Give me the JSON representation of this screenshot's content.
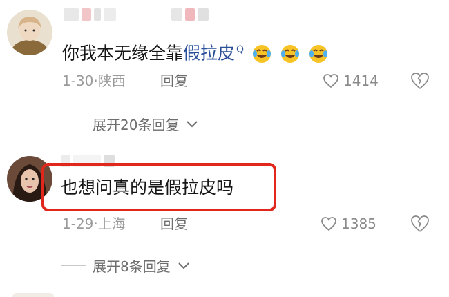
{
  "comments": [
    {
      "text_plain": "你我本无缘全靠",
      "text_link": "假拉皮",
      "search_glyph": "Q",
      "emoji_count": 3,
      "date": "1-30",
      "separator": "·",
      "location": "陕西",
      "reply_label": "回复",
      "likes": "1414",
      "expand_label": "展开20条回复"
    },
    {
      "text": "也想问真的是假拉皮吗",
      "date": "1-29",
      "separator": "·",
      "location": "上海",
      "reply_label": "回复",
      "likes": "1385",
      "expand_label": "展开8条回复"
    }
  ],
  "colors": {
    "highlight": "#e1261c",
    "link": "#2a4f99",
    "meta": "#9a9a9a"
  },
  "icons": [
    "heart-outline-icon",
    "broken-heart-icon",
    "chevron-down-icon",
    "laughing-crying-emoji-icon",
    "search-icon"
  ]
}
